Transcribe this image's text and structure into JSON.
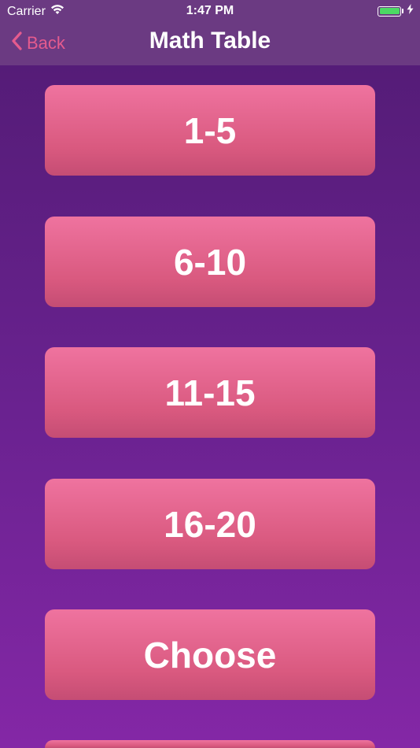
{
  "status_bar": {
    "carrier": "Carrier",
    "time": "1:47 PM",
    "wifi_icon": "wifi-icon",
    "battery_color": "#4cd964"
  },
  "nav": {
    "back_label": "Back",
    "title": "Math Table",
    "back_color": "#e55b8e"
  },
  "buttons": [
    {
      "label": "1-5"
    },
    {
      "label": "6-10"
    },
    {
      "label": "11-15"
    },
    {
      "label": "16-20"
    },
    {
      "label": "Choose"
    },
    {
      "label": ""
    }
  ],
  "colors": {
    "background_top": "#511b73",
    "background_bottom": "#8427a6",
    "nav_bar": "#6b3a82",
    "button_top": "#ef739f",
    "button_bottom": "#c54d74"
  }
}
